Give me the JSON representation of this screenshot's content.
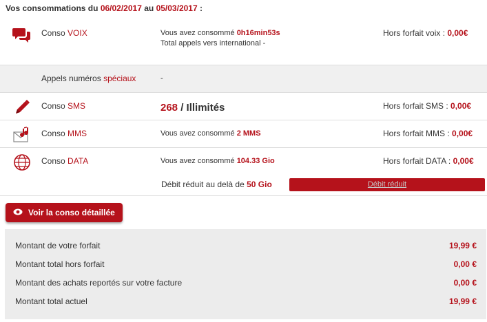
{
  "header": {
    "prefix": "Vos consommations du",
    "date_start": "06/02/2017",
    "middle": "au",
    "date_end": "05/03/2017",
    "suffix": ":"
  },
  "voix": {
    "icon": "speech-bubbles-icon",
    "label_prefix": "Conso",
    "label_accent": "VOIX",
    "line1_prefix": "Vous avez consommé",
    "line1_value": "0h16min53s",
    "line2": "Total appels vers international -",
    "right_label": "Hors forfait voix :",
    "right_value": "0,00€"
  },
  "speciaux": {
    "label_prefix": "Appels numéros",
    "label_accent": "spéciaux",
    "value": "-"
  },
  "sms": {
    "icon": "pencil-icon",
    "label_prefix": "Conso",
    "label_accent": "SMS",
    "count": "268",
    "count_suffix": "/ Illimités",
    "right_label": "Hors forfait SMS :",
    "right_value": "0,00€"
  },
  "mms": {
    "icon": "envelope-music-icon",
    "label_prefix": "Conso",
    "label_accent": "MMS",
    "line_prefix": "Vous avez consommé",
    "line_value": "2 MMS",
    "right_label": "Hors forfait MMS :",
    "right_value": "0,00€"
  },
  "data": {
    "icon": "globe-icon",
    "label_prefix": "Conso",
    "label_accent": "DATA",
    "line_prefix": "Vous avez consommé",
    "line_value": "104.33 Gio",
    "right_label": "Hors forfait DATA :",
    "right_value": "0,00€",
    "throttle_prefix": "Débit réduit au delà de",
    "throttle_value": "50 Gio",
    "bar_label": "Débit réduit",
    "bar_fill_fraction": 1.0
  },
  "button": {
    "icon": "eye-icon",
    "label": "Voir la conso détaillée"
  },
  "summary": [
    {
      "label": "Montant de votre forfait",
      "value": "19,99 €"
    },
    {
      "label": "Montant total hors forfait",
      "value": "0,00 €"
    },
    {
      "label": "Montant des achats reportés sur votre facture",
      "value": "0,00 €"
    },
    {
      "label": "Montant total actuel",
      "value": "19,99 €"
    }
  ],
  "colors": {
    "accent": "#b5121b",
    "panel_grey": "#ececec",
    "row_grey": "#f0f0f0"
  }
}
